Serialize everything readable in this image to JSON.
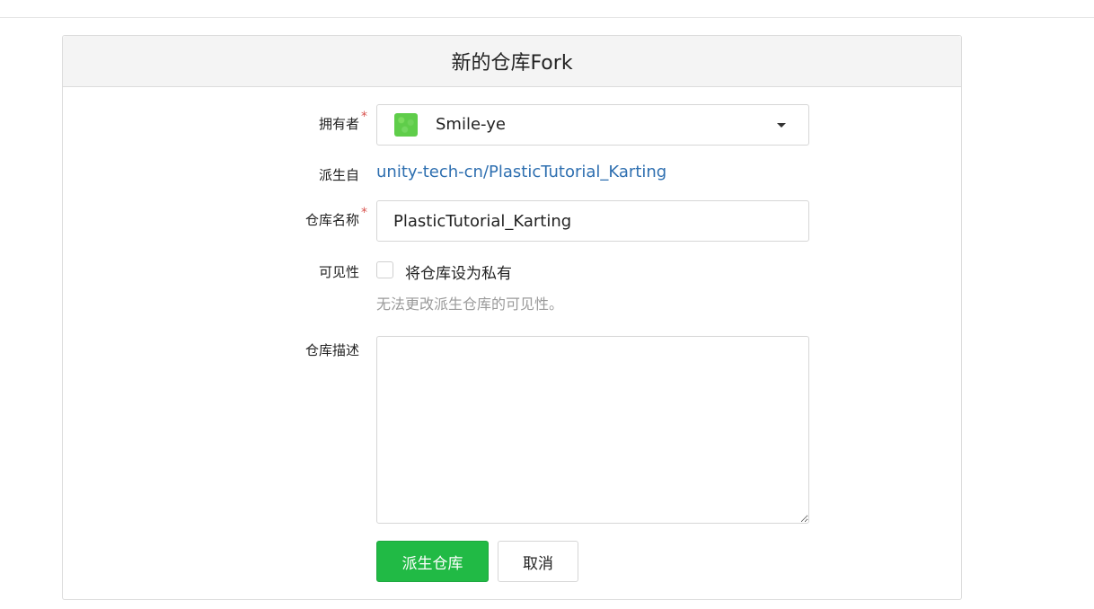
{
  "page": {
    "title": "新的仓库Fork"
  },
  "form": {
    "owner": {
      "label": "拥有者",
      "required_mark": "*",
      "selected": "Smile-ye"
    },
    "fork_from": {
      "label": "派生自",
      "link_text": "unity-tech-cn/PlasticTutorial_Karting"
    },
    "repo_name": {
      "label": "仓库名称",
      "required_mark": "*",
      "value": "PlasticTutorial_Karting"
    },
    "visibility": {
      "label": "可见性",
      "checkbox_label": "将仓库设为私有",
      "checked": false,
      "help": "无法更改派生仓库的可见性。"
    },
    "description": {
      "label": "仓库描述",
      "value": ""
    },
    "actions": {
      "submit_label": "派生仓库",
      "cancel_label": "取消"
    }
  },
  "colors": {
    "primary_button": "#21ba45",
    "link": "#2e6fb0",
    "required": "#d9534f",
    "header_bg": "#f4f4f4"
  }
}
